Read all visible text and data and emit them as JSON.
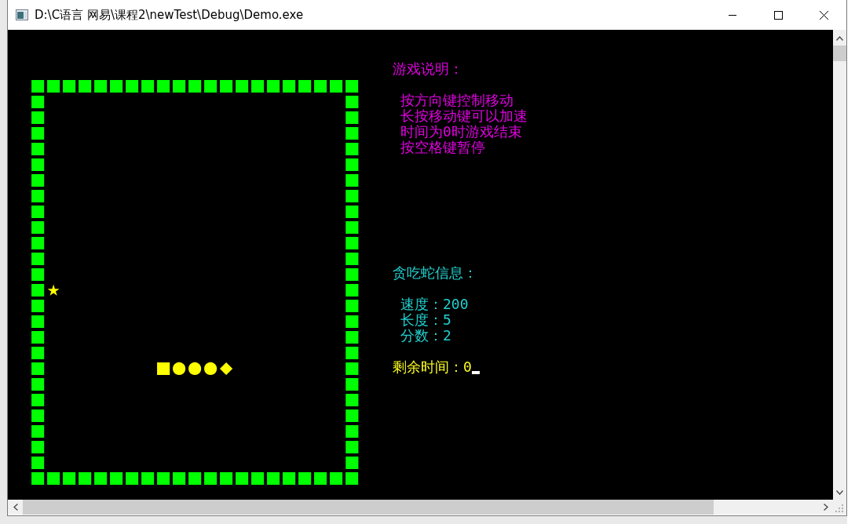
{
  "window": {
    "title": "D:\\C语言 网易\\课程2\\newTest\\Debug\\Demo.exe"
  },
  "board": {
    "rows": [
      [
        {
          "kind": "wall",
          "text": "■■■■■■■■■■■■■■■■■■■■■"
        }
      ],
      [
        {
          "kind": "wall",
          "text": "■"
        },
        {
          "kind": "gap",
          "text": "                   "
        },
        {
          "kind": "wall",
          "text": "■"
        }
      ],
      [
        {
          "kind": "wall",
          "text": "■"
        },
        {
          "kind": "gap",
          "text": "                   "
        },
        {
          "kind": "wall",
          "text": "■"
        }
      ],
      [
        {
          "kind": "wall",
          "text": "■"
        },
        {
          "kind": "gap",
          "text": "                   "
        },
        {
          "kind": "wall",
          "text": "■"
        }
      ],
      [
        {
          "kind": "wall",
          "text": "■"
        },
        {
          "kind": "gap",
          "text": "                   "
        },
        {
          "kind": "wall",
          "text": "■"
        }
      ],
      [
        {
          "kind": "wall",
          "text": "■"
        },
        {
          "kind": "gap",
          "text": "                   "
        },
        {
          "kind": "wall",
          "text": "■"
        }
      ],
      [
        {
          "kind": "wall",
          "text": "■"
        },
        {
          "kind": "gap",
          "text": "                   "
        },
        {
          "kind": "wall",
          "text": "■"
        }
      ],
      [
        {
          "kind": "wall",
          "text": "■"
        },
        {
          "kind": "gap",
          "text": "                   "
        },
        {
          "kind": "wall",
          "text": "■"
        }
      ],
      [
        {
          "kind": "wall",
          "text": "■"
        },
        {
          "kind": "gap",
          "text": "                   "
        },
        {
          "kind": "wall",
          "text": "■"
        }
      ],
      [
        {
          "kind": "wall",
          "text": "■"
        },
        {
          "kind": "gap",
          "text": "                   "
        },
        {
          "kind": "wall",
          "text": "■"
        }
      ],
      [
        {
          "kind": "wall",
          "text": "■"
        },
        {
          "kind": "gap",
          "text": "                   "
        },
        {
          "kind": "wall",
          "text": "■"
        }
      ],
      [
        {
          "kind": "wall",
          "text": "■"
        },
        {
          "kind": "gap",
          "text": "                   "
        },
        {
          "kind": "wall",
          "text": "■"
        }
      ],
      [
        {
          "kind": "wall",
          "text": "■"
        },
        {
          "kind": "gap",
          "text": "                   "
        },
        {
          "kind": "wall",
          "text": "■"
        }
      ],
      [
        {
          "kind": "wall",
          "text": "■"
        },
        {
          "kind": "food",
          "text": "★"
        },
        {
          "kind": "gap",
          "text": "                  "
        },
        {
          "kind": "wall",
          "text": "■"
        }
      ],
      [
        {
          "kind": "wall",
          "text": "■"
        },
        {
          "kind": "gap",
          "text": "                   "
        },
        {
          "kind": "wall",
          "text": "■"
        }
      ],
      [
        {
          "kind": "wall",
          "text": "■"
        },
        {
          "kind": "gap",
          "text": "                   "
        },
        {
          "kind": "wall",
          "text": "■"
        }
      ],
      [
        {
          "kind": "wall",
          "text": "■"
        },
        {
          "kind": "gap",
          "text": "                   "
        },
        {
          "kind": "wall",
          "text": "■"
        }
      ],
      [
        {
          "kind": "wall",
          "text": "■"
        },
        {
          "kind": "gap",
          "text": "                   "
        },
        {
          "kind": "wall",
          "text": "■"
        }
      ],
      [
        {
          "kind": "wall",
          "text": "■"
        },
        {
          "kind": "gap",
          "text": "       "
        },
        {
          "kind": "snake",
          "text": "■●●●◆"
        },
        {
          "kind": "gap",
          "text": "       "
        },
        {
          "kind": "wall",
          "text": "■"
        }
      ],
      [
        {
          "kind": "wall",
          "text": "■"
        },
        {
          "kind": "gap",
          "text": "                   "
        },
        {
          "kind": "wall",
          "text": "■"
        }
      ],
      [
        {
          "kind": "wall",
          "text": "■"
        },
        {
          "kind": "gap",
          "text": "                   "
        },
        {
          "kind": "wall",
          "text": "■"
        }
      ],
      [
        {
          "kind": "wall",
          "text": "■"
        },
        {
          "kind": "gap",
          "text": "                   "
        },
        {
          "kind": "wall",
          "text": "■"
        }
      ],
      [
        {
          "kind": "wall",
          "text": "■"
        },
        {
          "kind": "gap",
          "text": "                   "
        },
        {
          "kind": "wall",
          "text": "■"
        }
      ],
      [
        {
          "kind": "wall",
          "text": "■"
        },
        {
          "kind": "gap",
          "text": "                   "
        },
        {
          "kind": "wall",
          "text": "■"
        }
      ],
      [
        {
          "kind": "wall",
          "text": "■"
        },
        {
          "kind": "gap",
          "text": "                   "
        },
        {
          "kind": "wall",
          "text": "■"
        }
      ],
      [
        {
          "kind": "wall",
          "text": "■■■■■■■■■■■■■■■■■■■■■"
        }
      ]
    ]
  },
  "instructions": {
    "heading": "游戏说明：",
    "lines": [
      "按方向键控制移动",
      "长按移动键可以加速",
      "时间为0时游戏结束",
      "按空格键暂停"
    ]
  },
  "snake_info": {
    "heading": "贪吃蛇信息：",
    "lines": [
      "速度：200",
      "长度：5",
      "分数：2"
    ]
  },
  "time_left": {
    "text": "剩余时间：0",
    "cursor": true
  }
}
